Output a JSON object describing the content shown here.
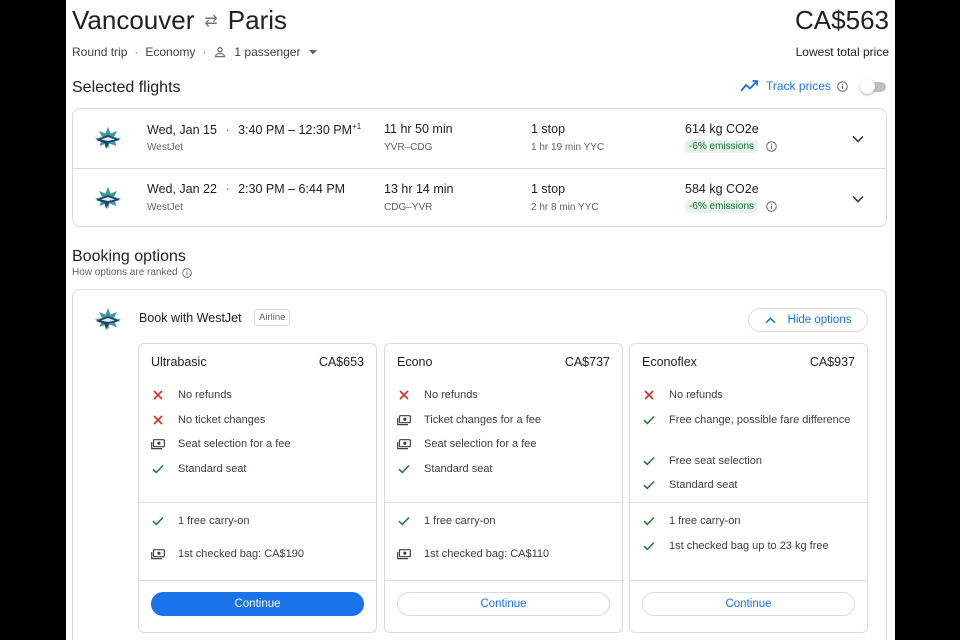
{
  "header": {
    "origin": "Vancouver",
    "destination": "Paris",
    "trip_type": "Round trip",
    "cabin": "Economy",
    "passengers": "1 passenger",
    "price": "CA$563",
    "price_caption": "Lowest total price"
  },
  "selected_flights": {
    "title": "Selected flights",
    "track_prices_label": "Track prices",
    "track_prices_enabled": false,
    "flights": [
      {
        "date": "Wed, Jan 15",
        "times": "3:40 PM – 12:30 PM",
        "next_day": "+1",
        "airline": "WestJet",
        "duration": "11 hr 50 min",
        "airports": "YVR–CDG",
        "stops": "1 stop",
        "layover": "1 hr 19 min YYC",
        "co2": "614 kg CO2e",
        "emissions": "-6% emissions"
      },
      {
        "date": "Wed, Jan 22",
        "times": "2:30 PM – 6:44 PM",
        "next_day": "",
        "airline": "WestJet",
        "duration": "13 hr 14 min",
        "airports": "CDG–YVR",
        "stops": "1 stop",
        "layover": "2 hr 8 min YYC",
        "co2": "584 kg CO2e",
        "emissions": "-6% emissions"
      }
    ]
  },
  "booking": {
    "title": "Booking options",
    "ranked_label": "How options are ranked",
    "book_with": "Book with WestJet",
    "airline_chip": "Airline",
    "hide_options": "Hide options",
    "fares": [
      {
        "name": "Ultrabasic",
        "price": "CA$653",
        "features": [
          {
            "icon": "x-icon",
            "text": "No refunds"
          },
          {
            "icon": "x-icon",
            "text": "No ticket changes"
          },
          {
            "icon": "money-icon",
            "text": "Seat selection for a fee"
          },
          {
            "icon": "check-icon",
            "text": "Standard seat"
          }
        ],
        "bags": [
          {
            "icon": "check-icon",
            "text": "1 free carry-on"
          },
          {
            "icon": "money-icon",
            "text": "1st checked bag: CA$190"
          }
        ],
        "button": "Continue",
        "primary": true
      },
      {
        "name": "Econo",
        "price": "CA$737",
        "features": [
          {
            "icon": "x-icon",
            "text": "No refunds"
          },
          {
            "icon": "money-icon",
            "text": "Ticket changes for a fee"
          },
          {
            "icon": "money-icon",
            "text": "Seat selection for a fee"
          },
          {
            "icon": "check-icon",
            "text": "Standard seat"
          }
        ],
        "bags": [
          {
            "icon": "check-icon",
            "text": "1 free carry-on"
          },
          {
            "icon": "money-icon",
            "text": "1st checked bag: CA$110"
          }
        ],
        "button": "Continue",
        "primary": false
      },
      {
        "name": "Econoflex",
        "price": "CA$937",
        "features": [
          {
            "icon": "x-icon",
            "text": "No refunds"
          },
          {
            "icon": "check-icon",
            "text": "Free change, possible fare difference"
          },
          {
            "icon": "check-icon",
            "text": "Free seat selection"
          },
          {
            "icon": "check-icon",
            "text": "Standard seat"
          }
        ],
        "bags": [
          {
            "icon": "check-icon",
            "text": "1 free carry-on"
          },
          {
            "icon": "check-icon",
            "text": "1st checked bag up to 23 kg free"
          }
        ],
        "button": "Continue",
        "primary": false
      }
    ]
  },
  "colors": {
    "accent": "#1a73e8",
    "brand_teal": "#3a9c94",
    "brand_navy": "#1d3f73",
    "negative": "#d93025",
    "positive": "#188038",
    "emissions_bg": "#e6f4ea"
  }
}
